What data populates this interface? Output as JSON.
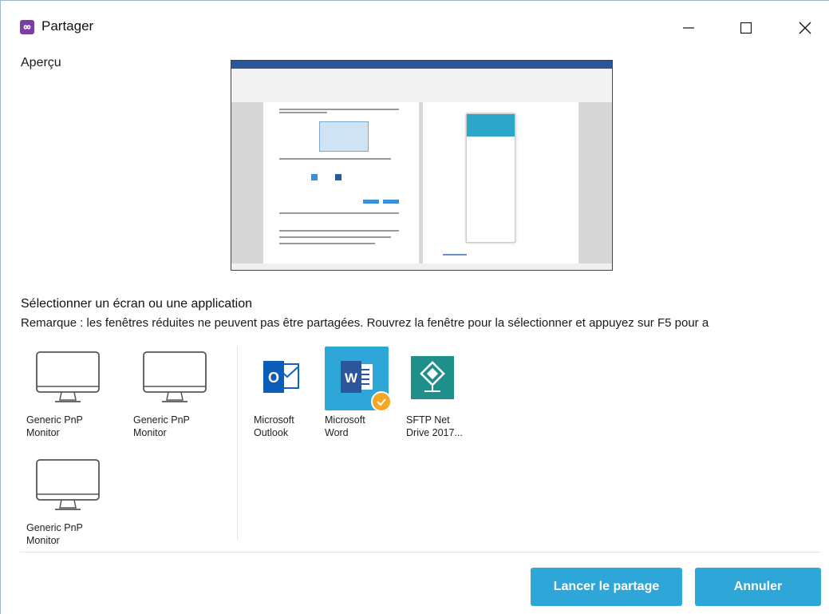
{
  "window": {
    "title": "Partager",
    "app_icon": "infinity-icon",
    "accent_color": "#2ea7d8",
    "minimize_icon": "minimize-icon",
    "maximize_icon": "maximize-icon",
    "close_icon": "close-icon"
  },
  "preview": {
    "label": "Aperçu"
  },
  "sources": {
    "heading": "Sélectionner un écran ou une application",
    "note": "Remarque : les fenêtres réduites ne peuvent pas être partagées. Rouvrez la fenêtre pour la sélectionner et appuyez sur F5 pour a",
    "screens": [
      {
        "label_line1": "Generic PnP",
        "label_line2": "Monitor",
        "icon": "monitor-icon"
      },
      {
        "label_line1": "Generic PnP",
        "label_line2": "Monitor",
        "icon": "monitor-icon"
      },
      {
        "label_line1": "Generic PnP",
        "label_line2": "Monitor",
        "icon": "monitor-icon"
      }
    ],
    "apps": [
      {
        "label_line1": "Microsoft",
        "label_line2": "Outlook",
        "icon": "outlook-icon",
        "selected": false
      },
      {
        "label_line1": "Microsoft",
        "label_line2": "Word",
        "icon": "word-icon",
        "selected": true
      },
      {
        "label_line1": "SFTP Net",
        "label_line2": "Drive 2017...",
        "icon": "sftp-net-drive-icon",
        "selected": false
      }
    ],
    "selected_badge_icon": "check-icon",
    "selected_badge_color": "#f5a623"
  },
  "buttons": {
    "start": "Lancer le partage",
    "cancel": "Annuler"
  }
}
